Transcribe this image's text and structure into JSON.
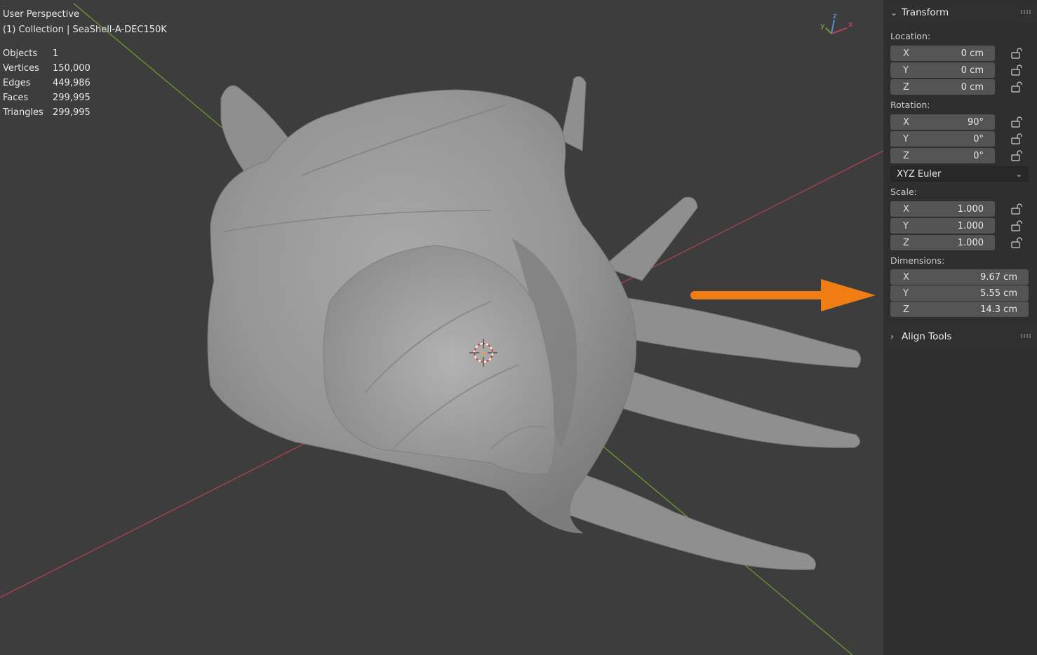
{
  "viewport": {
    "view_name": "User Perspective",
    "collection_line": "(1) Collection | SeaShell-A-DEC150K",
    "stats": [
      {
        "label": "Objects",
        "value": "1"
      },
      {
        "label": "Vertices",
        "value": "150,000"
      },
      {
        "label": "Edges",
        "value": "449,986"
      },
      {
        "label": "Faces",
        "value": "299,995"
      },
      {
        "label": "Triangles",
        "value": "299,995"
      }
    ],
    "gizmo": {
      "x": "x",
      "y": "y",
      "z": "z"
    },
    "colors": {
      "x_axis": "#b0414e",
      "y_axis": "#6f9a2c",
      "z_axis": "#4d8fd6",
      "highlight_arrow": "#f07d14"
    }
  },
  "panel": {
    "transform_title": "Transform",
    "location_label": "Location:",
    "location": [
      {
        "axis": "X",
        "value": "0 cm"
      },
      {
        "axis": "Y",
        "value": "0 cm"
      },
      {
        "axis": "Z",
        "value": "0 cm"
      }
    ],
    "rotation_label": "Rotation:",
    "rotation": [
      {
        "axis": "X",
        "value": "90°"
      },
      {
        "axis": "Y",
        "value": "0°"
      },
      {
        "axis": "Z",
        "value": "0°"
      }
    ],
    "rotation_mode": "XYZ Euler",
    "scale_label": "Scale:",
    "scale": [
      {
        "axis": "X",
        "value": "1.000"
      },
      {
        "axis": "Y",
        "value": "1.000"
      },
      {
        "axis": "Z",
        "value": "1.000"
      }
    ],
    "dimensions_label": "Dimensions:",
    "dimensions": [
      {
        "axis": "X",
        "value": "9.67 cm"
      },
      {
        "axis": "Y",
        "value": "5.55 cm"
      },
      {
        "axis": "Z",
        "value": "14.3 cm"
      }
    ],
    "align_tools_title": "Align Tools"
  }
}
